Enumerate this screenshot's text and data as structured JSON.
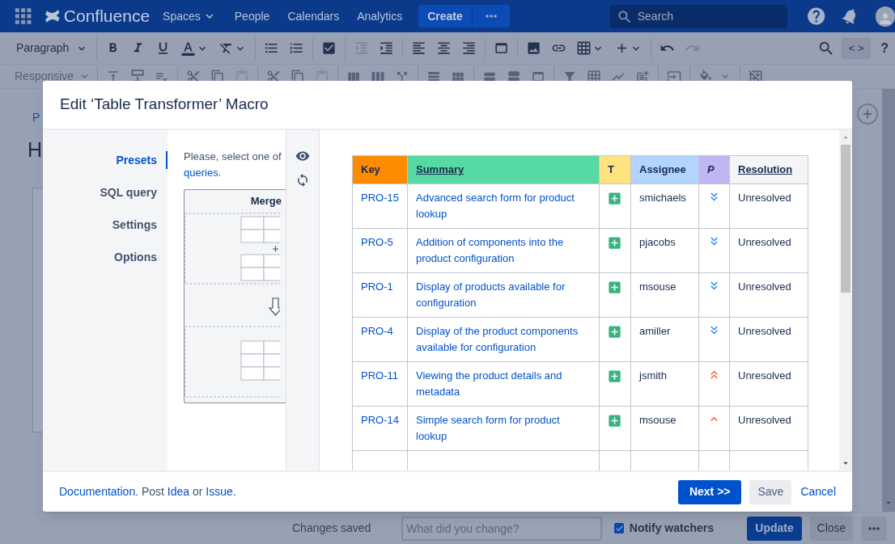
{
  "nav": {
    "product": "Confluence",
    "links": [
      {
        "label": "Spaces",
        "dropdown": true
      },
      {
        "label": "People",
        "dropdown": false
      },
      {
        "label": "Calendars",
        "dropdown": false
      },
      {
        "label": "Analytics",
        "dropdown": false
      }
    ],
    "create": "Create",
    "search": {
      "placeholder": "Search"
    }
  },
  "toolbar": {
    "style_select": "Paragraph",
    "row1": [
      {
        "disabled": false
      },
      {
        "disabled": false
      },
      {
        "disabled": false
      },
      {
        "disabled": false
      },
      {
        "disabled": false
      },
      {
        "disabled": false
      },
      {
        "disabled": false
      },
      {
        "disabled": false
      },
      {
        "disabled": true
      },
      {
        "disabled": false
      },
      {
        "disabled": false
      },
      {
        "disabled": false
      },
      {
        "disabled": false
      },
      {
        "disabled": false
      },
      {
        "disabled": false
      },
      {
        "disabled": false
      },
      {
        "disabled": false
      },
      {
        "disabled": false
      },
      {
        "disabled": false
      },
      {
        "disabled": true
      }
    ],
    "source_button": "< >",
    "help": "?",
    "row2_select": {
      "label": "Responsive",
      "disabled": true
    },
    "row2": [
      {
        "disabled": false
      },
      {
        "disabled": false
      },
      {
        "disabled": false
      },
      {
        "disabled": false
      },
      {
        "disabled": false
      },
      {
        "disabled": true
      },
      {
        "disabled": false
      },
      {
        "disabled": false
      },
      {
        "disabled": true
      },
      {
        "disabled": false
      },
      {
        "disabled": false
      },
      {
        "disabled": false
      },
      {
        "disabled": false
      },
      {
        "disabled": false
      },
      {
        "disabled": false
      },
      {
        "disabled": false
      },
      {
        "disabled": false
      },
      {
        "disabled": false
      },
      {
        "disabled": false
      },
      {
        "disabled": false
      },
      {
        "disabled": false
      },
      {
        "disabled": false
      },
      {
        "disabled": false
      },
      {
        "disabled": false
      }
    ]
  },
  "page": {
    "breadcrumb": "P",
    "title": "H"
  },
  "dialog": {
    "title": "Edit ‘Table Transformer’ Macro",
    "sidebar": [
      {
        "label": "Presets",
        "selected": true
      },
      {
        "label": "SQL query",
        "selected": false
      },
      {
        "label": "Settings",
        "selected": false
      },
      {
        "label": "Options",
        "selected": false
      }
    ],
    "presets": {
      "intro": "Please, select one of",
      "intro_link": "queries.",
      "card_title": "Merge"
    },
    "table": {
      "columns": [
        {
          "label": "Key",
          "color": "#ff8b00"
        },
        {
          "label": "Summary",
          "color": "#57d9a3"
        },
        {
          "label": "T",
          "color": "#ffe380"
        },
        {
          "label": "Assignee",
          "color": "#b3d4ff"
        },
        {
          "label": "P",
          "color": "#c0b6f2"
        },
        {
          "label": "Resolution",
          "color": "#f4f5f7"
        }
      ],
      "rows": [
        {
          "key": "PRO-15",
          "summary": "Advanced search form for product lookup",
          "assignee": "smichaels",
          "kind": "lowest",
          "resolution": "Unresolved"
        },
        {
          "key": "PRO-5",
          "summary": "Addition of components into the product configuration",
          "assignee": "pjacobs",
          "kind": "lowest",
          "resolution": "Unresolved"
        },
        {
          "key": "PRO-1",
          "summary": "Display of products available for configuration",
          "assignee": "msouse",
          "kind": "lowest",
          "resolution": "Unresolved"
        },
        {
          "key": "PRO-4",
          "summary": "Display of the product components available for configuration",
          "assignee": "amiller",
          "kind": "lowest",
          "resolution": "Unresolved"
        },
        {
          "key": "PRO-11",
          "summary": "Viewing the product details and metadata",
          "assignee": "jsmith",
          "kind": "highest",
          "resolution": "Unresolved"
        },
        {
          "key": "PRO-14",
          "summary": "Simple search form for product lookup",
          "assignee": "msouse",
          "kind": "high",
          "resolution": "Unresolved"
        }
      ]
    },
    "footer": {
      "doc_link": "Documentation",
      "post": ". Post ",
      "idea_link": "Idea",
      "or": " or ",
      "issue_link": "Issue",
      "end": "."
    },
    "buttons": {
      "next": "Next >>",
      "save": "Save",
      "cancel": "Cancel"
    }
  },
  "bottom_bar": {
    "status": "Changes saved",
    "comment": {
      "placeholder": "What did you change?"
    },
    "notify": {
      "label": "Notify watchers",
      "checked": true
    },
    "update": "Update",
    "close": "Close"
  }
}
